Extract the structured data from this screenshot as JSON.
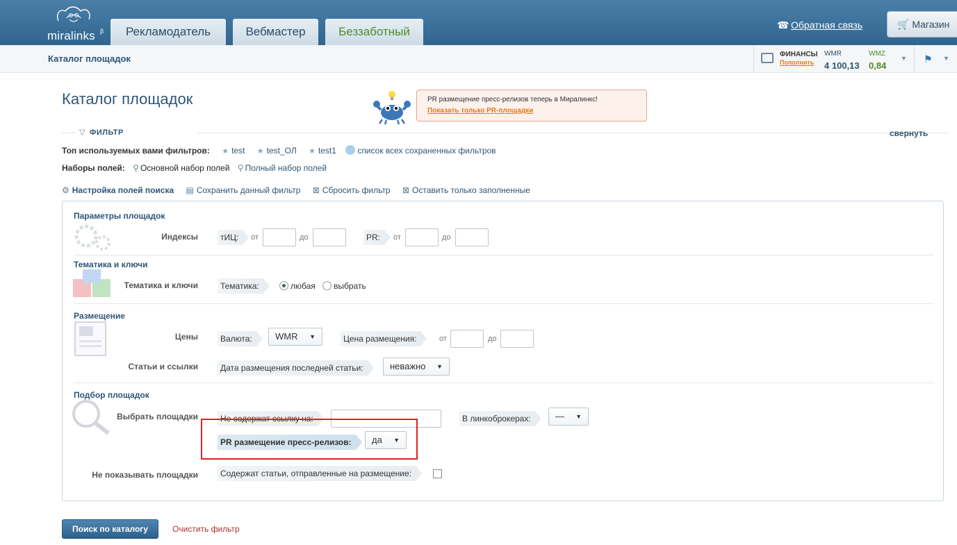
{
  "header": {
    "logo_text": "miralinks",
    "logo_beta": "β",
    "tabs": [
      {
        "label": "Рекламодатель"
      },
      {
        "label": "Вебмастер"
      },
      {
        "label": "Беззаботный"
      }
    ],
    "feedback": "Обратная связь",
    "shop": "Магазин",
    "colors": {
      "bar": "#2f6590",
      "accent_green": "#4f8a2a"
    }
  },
  "subbar": {
    "breadcrumb": "Каталог площадок",
    "finance": {
      "title": "ФИНАНСЫ",
      "topup": "Пополнить",
      "wmr_label": "WMR",
      "wmr_value": "4 100,13",
      "wmz_label": "WMZ",
      "wmz_value": "0,84"
    }
  },
  "page": {
    "title": "Каталог площадок",
    "promo": {
      "text": "PR размещение пресс-релизов теперь в Миралинкс!",
      "link": "Показать только PR-площадки"
    },
    "filter": {
      "header": "ФИЛЬТР",
      "collapse": "свернуть",
      "top_filters_label": "Топ используемых вами фильтров:",
      "top_filters": [
        "test",
        "test_ОЛ",
        "test1"
      ],
      "all_saved": "список всех сохраненных фильтров",
      "field_sets_label": "Наборы полей:",
      "field_set_main": "Основной набор полей",
      "field_set_full": "Полный набор полей",
      "actions": [
        "Настройка полей поиска",
        "Сохранить данный фильтр",
        "Сбросить фильтр",
        "Оставить только заполненные"
      ]
    },
    "panel": {
      "sec1": {
        "title": "Параметры площадок",
        "row_label": "Индексы",
        "tic": "тИЦ:",
        "pr": "PR:",
        "from": "от",
        "to": "до"
      },
      "sec2": {
        "title": "Тематика и ключи",
        "row_label": "Тематика и ключи",
        "tag": "Тематика:",
        "opt_any": "любая",
        "opt_choose": "выбрать"
      },
      "sec3": {
        "title": "Размещение",
        "row1_label": "Цены",
        "currency_tag": "Валюта:",
        "currency_value": "WMR",
        "price_tag": "Цена размещения:",
        "from": "от",
        "to": "до",
        "row2_label": "Статьи и ссылки",
        "last_date_tag": "Дата размещения последней статьи:",
        "last_date_value": "неважно"
      },
      "sec4": {
        "title": "Подбор площадок",
        "row1_label": "Выбрать площадки",
        "nolink_tag": "Не содержат ссылку на:",
        "brokers_tag": "В линкоброкерах:",
        "brokers_value": "—",
        "pr_tag": "PR размещение пресс-релизов:",
        "pr_value": "да",
        "row2_label": "Не показывать площадки",
        "sent_tag": "Содержат статьи, отправленные на размещение:"
      }
    },
    "search_button": "Поиск по каталогу",
    "clear_filter": "Очистить фильтр"
  }
}
